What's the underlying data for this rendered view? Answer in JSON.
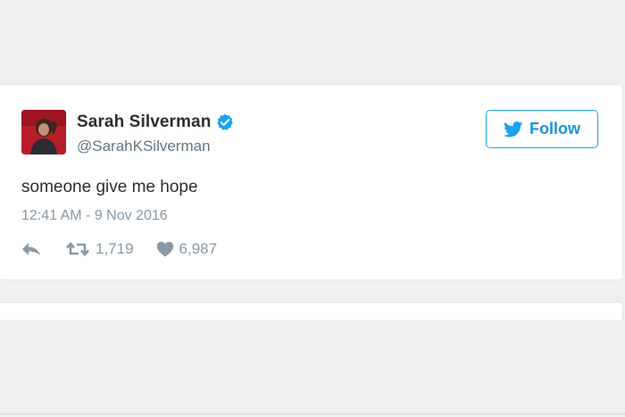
{
  "tweet": {
    "author": {
      "display_name": "Sarah Silverman",
      "handle": "@SarahKSilverman",
      "verified_icon": "verified-badge-icon"
    },
    "follow_label": "Follow",
    "text": "someone give me hope",
    "timestamp": "12:41 AM - 9 Nov 2016",
    "actions": {
      "reply_icon": "reply-icon",
      "retweet_icon": "retweet-icon",
      "retweet_count": "1,719",
      "like_icon": "heart-icon",
      "like_count": "6,987"
    }
  },
  "colors": {
    "accent": "#1da1f2",
    "text_primary": "#292f33",
    "text_secondary": "#8899a6",
    "background": "#efefef",
    "card": "#ffffff"
  }
}
